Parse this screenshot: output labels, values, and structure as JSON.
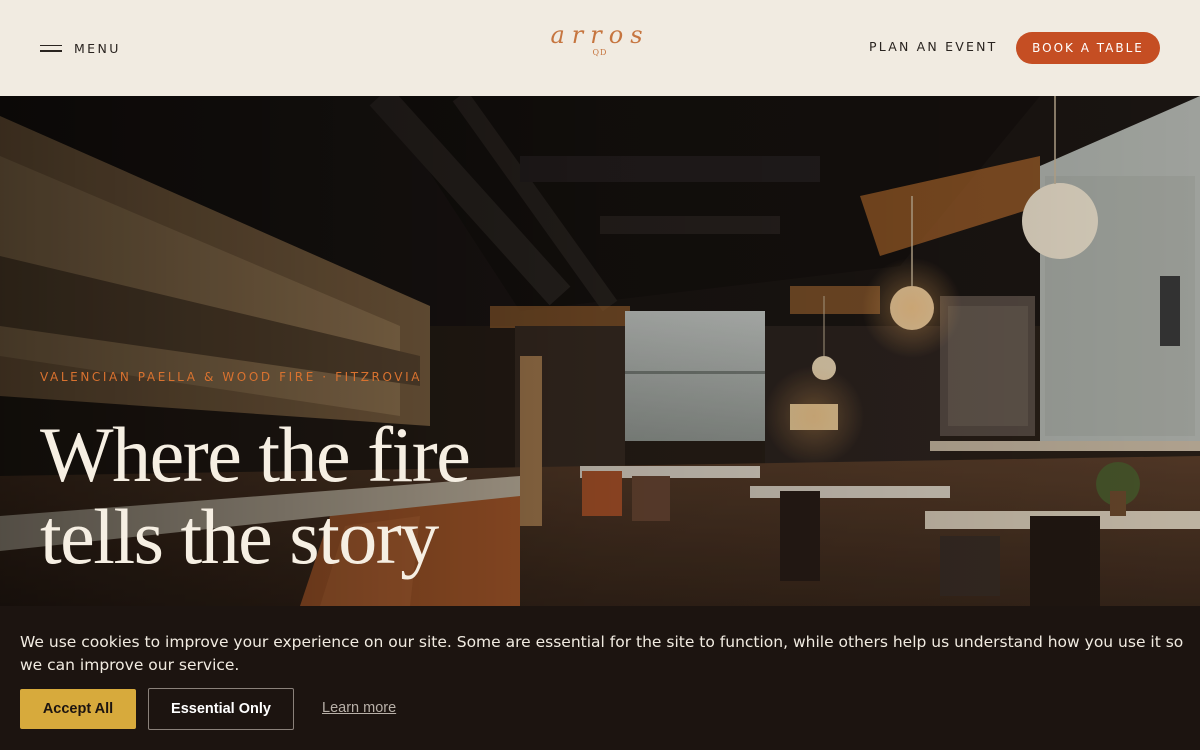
{
  "header": {
    "menu_label": "MENU",
    "logo_main": "arros",
    "logo_sub": "QD",
    "plan_event_label": "PLAN AN EVENT",
    "book_label": "BOOK A TABLE"
  },
  "hero": {
    "eyebrow": "VALENCIAN PAELLA & WOOD FIRE · FITZROVIA",
    "headline_line1": "Where the fire",
    "headline_line2": "tells the story"
  },
  "cookie": {
    "message": "We use cookies to improve your experience on our site. Some are essential for the site to function, while others help us understand how you use it so we can improve our service.",
    "accept_label": "Accept All",
    "essential_label": "Essential Only",
    "learn_more_label": "Learn more"
  },
  "colors": {
    "header_bg": "#f1ebe1",
    "brand_accent": "#c6753f",
    "book_button": "#c54e23",
    "accept_button": "#d7aa3c",
    "banner_bg": "#1c1410"
  }
}
